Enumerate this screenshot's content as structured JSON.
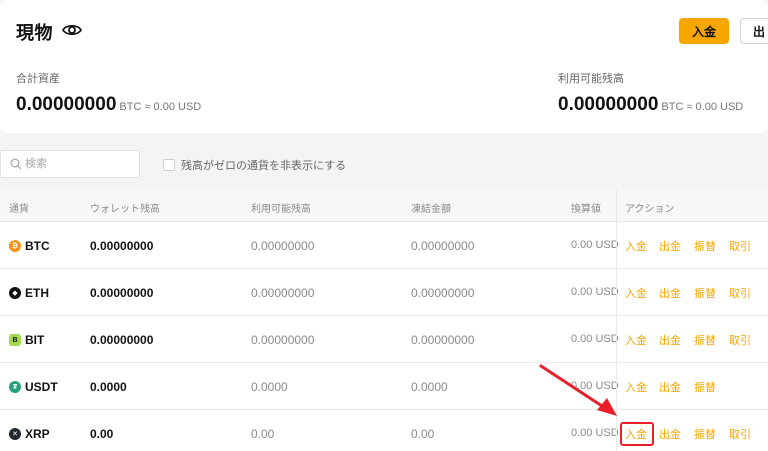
{
  "header": {
    "title": "現物",
    "deposit_label": "入金",
    "withdraw_label": "出"
  },
  "assets": {
    "total": {
      "label": "合計資産",
      "value": "0.00000000",
      "sub": "BTC ≈ 0.00 USD"
    },
    "available": {
      "label": "利用可能残高",
      "value": "0.00000000",
      "sub": "BTC ≈ 0.00 USD"
    }
  },
  "filters": {
    "search_placeholder": "検索",
    "hide_zero_label": "残高がゼロの通貨を非表示にする"
  },
  "table": {
    "headers": {
      "currency": "通貨",
      "wallet": "ウォレット残高",
      "available": "利用可能残高",
      "frozen": "凍結金額",
      "converted": "換算値",
      "actions": "アクション"
    },
    "rows": [
      {
        "coin": "BTC",
        "icon": "btc-icon",
        "icon_color": "#f7931a",
        "wallet": "0.00000000",
        "available": "0.00000000",
        "frozen": "0.00000000",
        "usd": "0.00 USD",
        "actions": [
          "入金",
          "出金",
          "振替",
          "取引"
        ]
      },
      {
        "coin": "ETH",
        "icon": "eth-icon",
        "icon_color": "#121214",
        "wallet": "0.00000000",
        "available": "0.00000000",
        "frozen": "0.00000000",
        "usd": "0.00 USD",
        "actions": [
          "入金",
          "出金",
          "振替",
          "取引"
        ]
      },
      {
        "coin": "BIT",
        "icon": "bit-icon",
        "icon_color": "#a3d94a",
        "wallet": "0.00000000",
        "available": "0.00000000",
        "frozen": "0.00000000",
        "usd": "0.00 USD",
        "actions": [
          "入金",
          "出金",
          "振替",
          "取引"
        ]
      },
      {
        "coin": "USDT",
        "icon": "usdt-icon",
        "icon_color": "#26a17b",
        "wallet": "0.0000",
        "available": "0.0000",
        "frozen": "0.0000",
        "usd": "0.00 USD",
        "actions": [
          "入金",
          "出金",
          "振替"
        ]
      },
      {
        "coin": "XRP",
        "icon": "xrp-icon",
        "icon_color": "#23292f",
        "wallet": "0.00",
        "available": "0.00",
        "frozen": "0.00",
        "usd": "0.00 USD",
        "actions": [
          "入金",
          "出金",
          "振替",
          "取引"
        ]
      }
    ]
  },
  "annotation": {
    "color": "#e8202b"
  },
  "colors": {
    "accent": "#f7a600"
  }
}
